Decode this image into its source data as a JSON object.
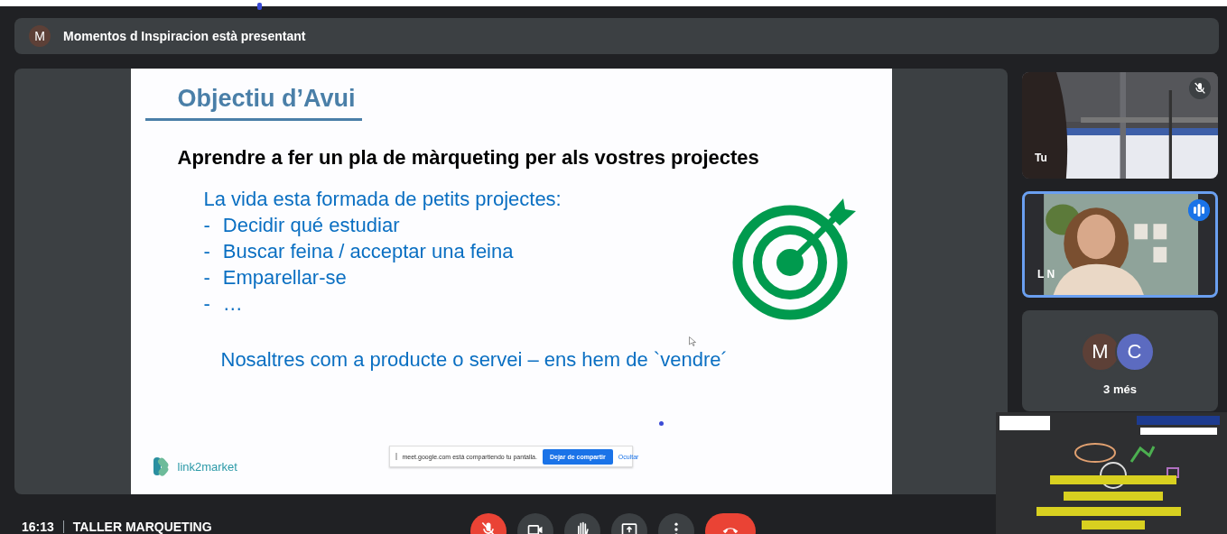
{
  "presenter_bar": {
    "avatar": "M",
    "text": "Momentos d Inspiracion està presentant"
  },
  "slide": {
    "title": "Objectiu d’Avui",
    "heading": "Aprendre a fer un pla de màrqueting per als vostres projectes",
    "intro": "La vida esta formada de petits projectes:",
    "bullets": [
      {
        "dash": "-",
        "text": "Decidir qué estudiar"
      },
      {
        "dash": "-",
        "text": "Buscar feina / acceptar una feina"
      },
      {
        "dash": "-",
        "text": "Emparellar-se"
      },
      {
        "dash": "-",
        "text": "…"
      }
    ],
    "closing": "Nosaltres com a producte o servei – ens hem de `vendre´",
    "logo_text": "link2market"
  },
  "share_banner": {
    "message": "meet.google.com está compartiendo tu pantalla.",
    "stop_button": "Dejar de compartir",
    "hide_link": "Ocultar"
  },
  "participants": [
    {
      "name": "Tu",
      "kind": "room",
      "muted": true,
      "speaking": false
    },
    {
      "name": "L N",
      "kind": "person",
      "muted": false,
      "speaking": true
    }
  ],
  "more": {
    "avatars": [
      {
        "letter": "M",
        "color": "#5d4037"
      },
      {
        "letter": "C",
        "color": "#5c6bc0"
      }
    ],
    "label": "3 més"
  },
  "footer": {
    "time": "16:13",
    "meeting": "TALLER MARQUETING"
  },
  "controls": [
    {
      "kind": "mic",
      "muted": true
    },
    {
      "kind": "camera"
    },
    {
      "kind": "hand"
    },
    {
      "kind": "present"
    },
    {
      "kind": "more"
    },
    {
      "kind": "leave"
    }
  ]
}
